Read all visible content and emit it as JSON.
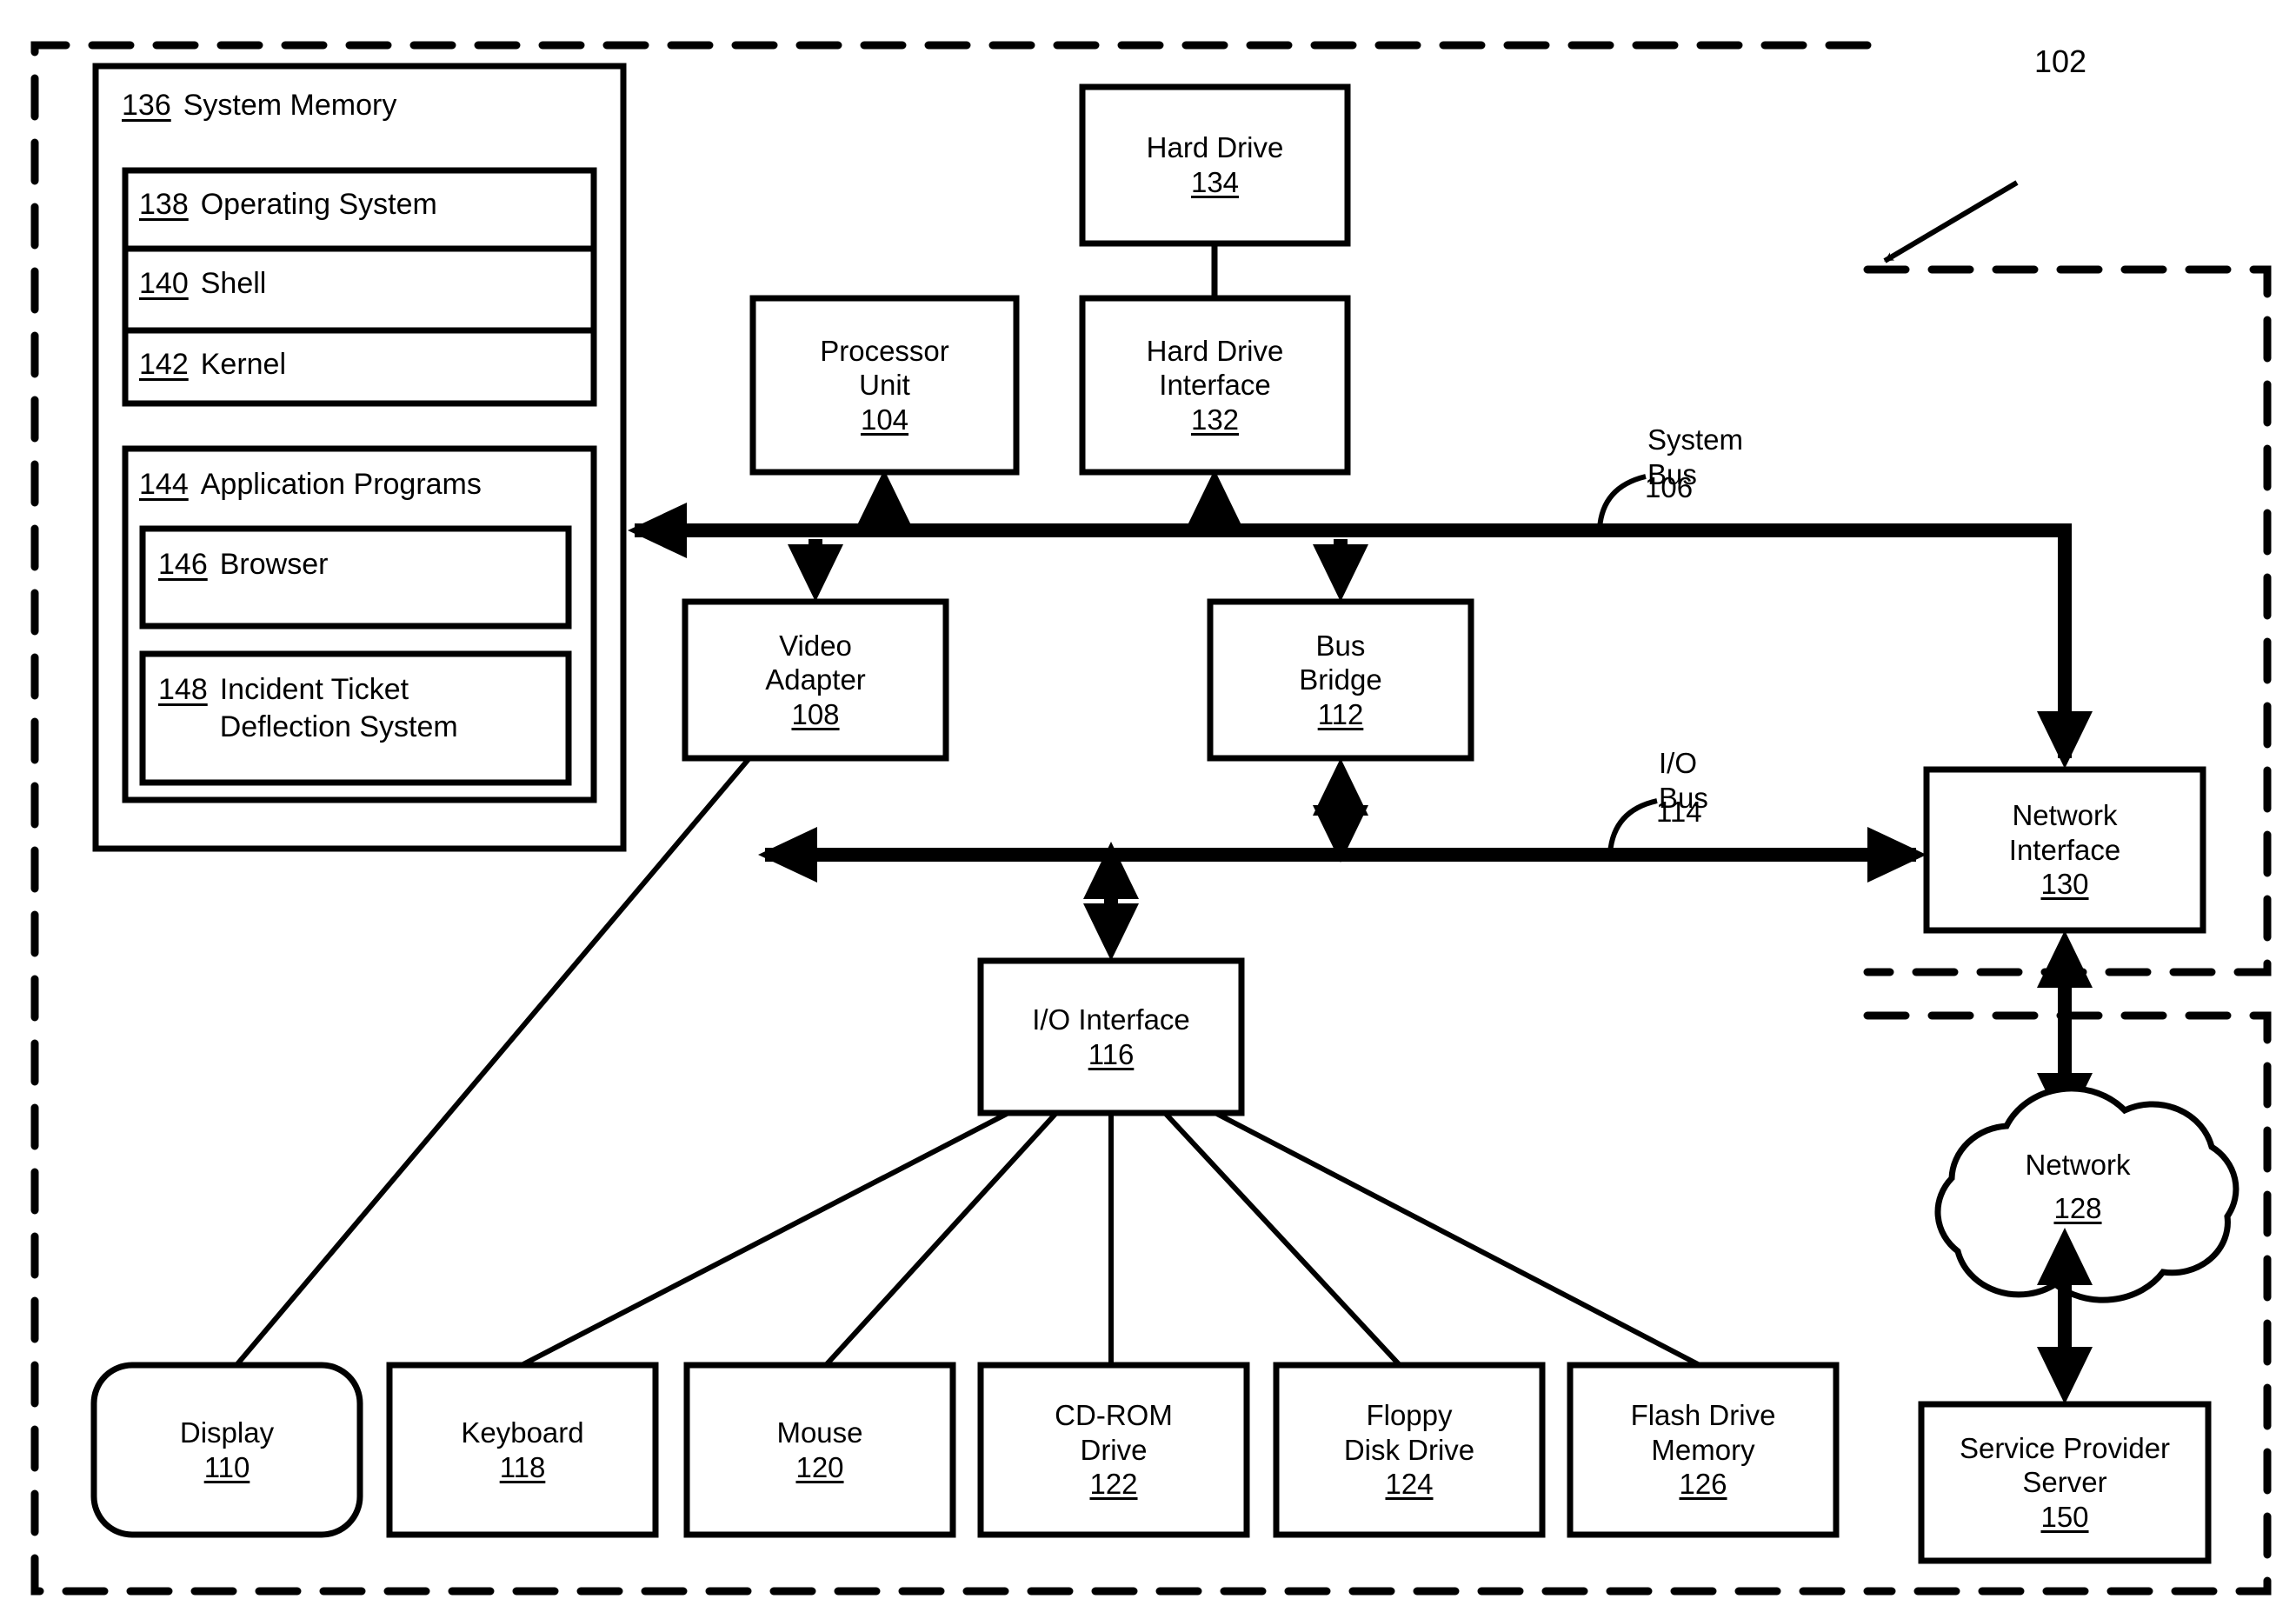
{
  "figure": {
    "system_ref": "102",
    "bus_labels": [
      {
        "ref": "106",
        "name": "System\nBus"
      },
      {
        "ref": "114",
        "name": "I/O\nBus"
      }
    ]
  },
  "memory": {
    "ref": "136",
    "title": "System Memory",
    "os_group": [
      {
        "ref": "138",
        "label": "Operating System"
      },
      {
        "ref": "140",
        "label": "Shell"
      },
      {
        "ref": "142",
        "label": "Kernel"
      }
    ],
    "apps": {
      "ref": "144",
      "label": "Application Programs",
      "items": [
        {
          "ref": "146",
          "label": "Browser"
        },
        {
          "ref": "148",
          "label": "Incident Ticket\nDeflection System"
        }
      ]
    }
  },
  "blocks": {
    "hard_drive": {
      "ref": "134",
      "label": "Hard Drive"
    },
    "hard_drive_iface": {
      "ref": "132",
      "label": "Hard Drive\nInterface"
    },
    "processor": {
      "ref": "104",
      "label": "Processor\nUnit"
    },
    "video_adapter": {
      "ref": "108",
      "label": "Video\nAdapter"
    },
    "bus_bridge": {
      "ref": "112",
      "label": "Bus\nBridge"
    },
    "network_interface": {
      "ref": "130",
      "label": "Network\nInterface"
    },
    "io_interface": {
      "ref": "116",
      "label": "I/O Interface"
    },
    "network": {
      "ref": "128",
      "label": "Network"
    },
    "service_provider": {
      "ref": "150",
      "label": "Service Provider\nServer"
    }
  },
  "peripherals": [
    {
      "ref": "110",
      "label": "Display"
    },
    {
      "ref": "118",
      "label": "Keyboard"
    },
    {
      "ref": "120",
      "label": "Mouse"
    },
    {
      "ref": "122",
      "label": "CD-ROM\nDrive"
    },
    {
      "ref": "124",
      "label": "Floppy\nDisk Drive"
    },
    {
      "ref": "126",
      "label": "Flash Drive\nMemory"
    }
  ],
  "style": {
    "ink": "#000000",
    "paper": "#ffffff"
  }
}
